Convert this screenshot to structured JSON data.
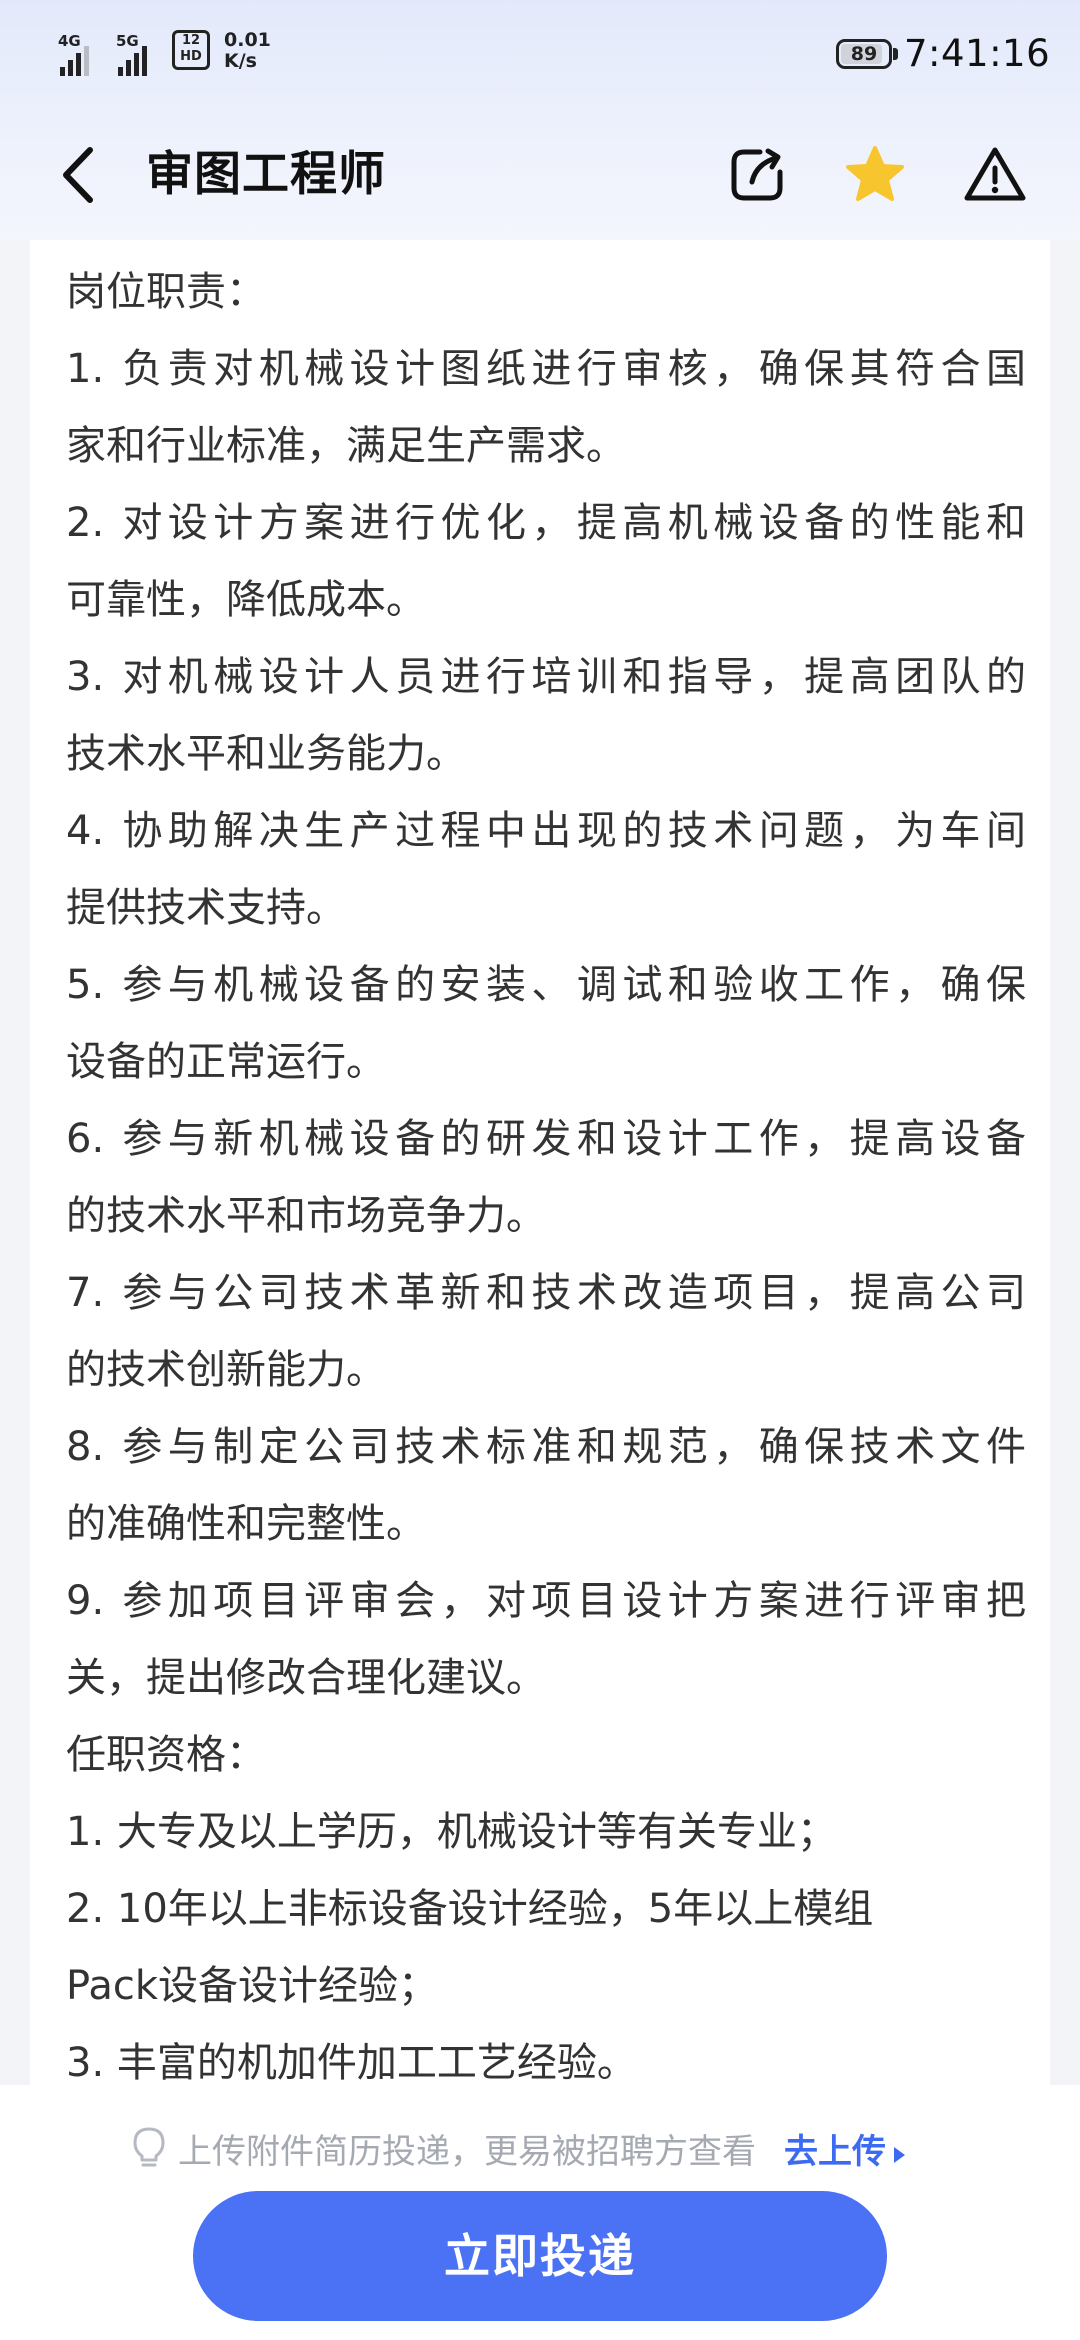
{
  "status_bar": {
    "network1": "4G",
    "network2": "5G",
    "hd_badge": "HD",
    "hd_digits": "12",
    "speed_value": "0.01",
    "speed_unit": "K/s",
    "battery_level": "89",
    "time": "7:41:16"
  },
  "nav": {
    "title": "审图工程师"
  },
  "content": {
    "lines": [
      "岗位职责：",
      "1. 负责对机械设计图纸进行审核，确保其符合国",
      "家和行业标准，满足生产需求。",
      "2. 对设计方案进行优化，提高机械设备的性能和",
      "可靠性，降低成本。",
      "3. 对机械设计人员进行培训和指导，提高团队的",
      "技术水平和业务能力。",
      "4. 协助解决生产过程中出现的技术问题，为车间",
      "提供技术支持。",
      "5. 参与机械设备的安装、调试和验收工作，确保",
      "设备的正常运行。",
      "6. 参与新机械设备的研发和设计工作，提高设备",
      "的技术水平和市场竞争力。",
      "7. 参与公司技术革新和技术改造项目，提高公司",
      "的技术创新能力。",
      "8. 参与制定公司技术标准和规范，确保技术文件",
      "的准确性和完整性。",
      "9. 参加项目评审会，对项目设计方案进行评审把",
      "关，提出修改合理化建议。",
      "任职资格：",
      "1. 大专及以上学历，机械设计等有关专业；",
      "2. 10年以上非标设备设计经验，5年以上模组",
      "Pack设备设计经验；",
      "3. 丰富的机加件加工工艺经验。"
    ]
  },
  "footer": {
    "tip_text": "上传附件简历投递，更易被招聘方查看",
    "tip_link": "去上传",
    "apply_label": "立即投递"
  },
  "colors": {
    "accent": "#4b72f5",
    "link": "#3d6af2",
    "star": "#f7c62f"
  },
  "icons": [
    "back-arrow-icon",
    "share-icon",
    "star-icon",
    "warning-icon",
    "lightbulb-icon"
  ]
}
